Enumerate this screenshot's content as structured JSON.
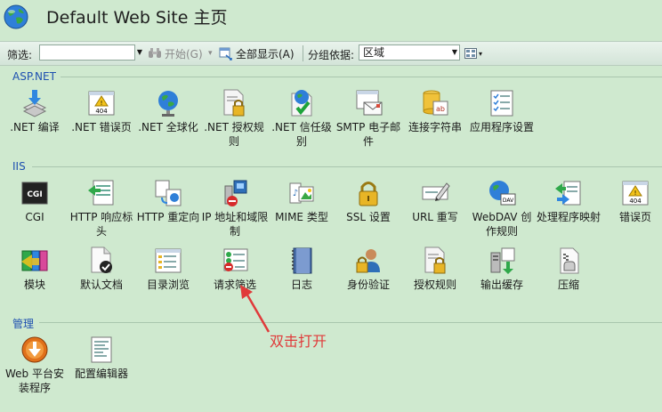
{
  "header": {
    "title": "Default Web Site 主页"
  },
  "toolbar": {
    "filter_label": "筛选:",
    "filter_value": "",
    "start_label": "开始(G)",
    "show_all_label": "全部显示(A)",
    "group_by_label": "分组依据:",
    "group_by_value": "区域"
  },
  "sections": [
    {
      "label": "ASP.NET",
      "items": [
        ".NET 编译",
        ".NET 错误页",
        ".NET 全球化",
        ".NET 授权规则",
        ".NET 信任级别",
        "SMTP 电子邮件",
        "连接字符串",
        "应用程序设置"
      ]
    },
    {
      "label": "IIS",
      "items": [
        "CGI",
        "HTTP 响应标头",
        "HTTP 重定向",
        "IP 地址和域限制",
        "MIME 类型",
        "SSL 设置",
        "URL 重写",
        "WebDAV 创作规则",
        "处理程序映射",
        "错误页",
        "模块",
        "默认文档",
        "目录浏览",
        "请求筛选",
        "日志",
        "身份验证",
        "授权规则",
        "输出缓存",
        "压缩"
      ]
    },
    {
      "label": "管理",
      "items": [
        "Web 平台安装程序",
        "配置编辑器"
      ]
    }
  ],
  "annotation": "双击打开",
  "colors": {
    "background": "#cfe9cf",
    "section_label": "#1e50b0",
    "annotation": "#e03a3a"
  }
}
